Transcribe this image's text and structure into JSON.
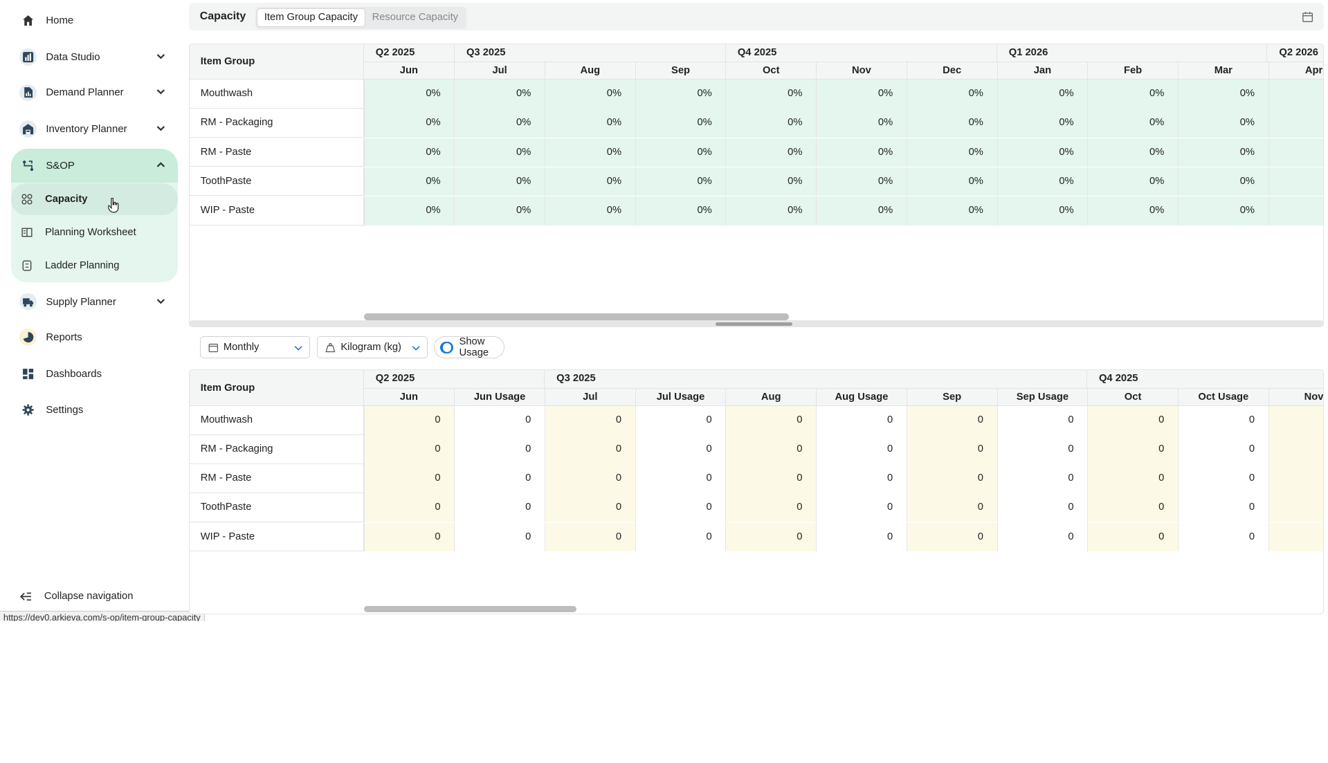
{
  "nav": {
    "items": [
      {
        "label": "Home",
        "icon": "home-icon"
      },
      {
        "label": "Data Studio",
        "icon": "bar-chart-icon"
      },
      {
        "label": "Demand Planner",
        "icon": "document-chart-icon"
      },
      {
        "label": "Inventory Planner",
        "icon": "warehouse-icon"
      },
      {
        "label": "S&OP",
        "icon": "route-icon"
      },
      {
        "label": "Supply Planner",
        "icon": "truck-icon"
      },
      {
        "label": "Reports",
        "icon": "pie-chart-icon"
      },
      {
        "label": "Dashboards",
        "icon": "dashboard-grid-icon"
      },
      {
        "label": "Settings",
        "icon": "gear-icon"
      }
    ],
    "sop_children": [
      {
        "label": "Capacity",
        "icon": "grid-dots-icon"
      },
      {
        "label": "Planning Worksheet",
        "icon": "worksheet-icon"
      },
      {
        "label": "Ladder Planning",
        "icon": "ladder-icon"
      }
    ],
    "collapse_label": "Collapse navigation",
    "accent_color": "#c9ecdb"
  },
  "status_url": "https://dev0.arkieva.com/s-op/item-group-capacity",
  "header": {
    "title": "Capacity",
    "tabs": [
      {
        "label": "Item Group Capacity",
        "active": true
      },
      {
        "label": "Resource Capacity",
        "active": false
      }
    ]
  },
  "top_grid": {
    "row_header": "Item Group",
    "quarters": [
      "Q2 2025",
      "Q3 2025",
      "Q4 2025",
      "Q1 2026",
      "Q2 2026"
    ],
    "months": [
      "Jun",
      "Jul",
      "Aug",
      "Sep",
      "Oct",
      "Nov",
      "Dec",
      "Jan",
      "Feb",
      "Mar",
      "Apr"
    ],
    "rows": [
      {
        "name": "Mouthwash",
        "values": [
          "0%",
          "0%",
          "0%",
          "0%",
          "0%",
          "0%",
          "0%",
          "0%",
          "0%",
          "0%",
          ""
        ]
      },
      {
        "name": "RM - Packaging",
        "values": [
          "0%",
          "0%",
          "0%",
          "0%",
          "0%",
          "0%",
          "0%",
          "0%",
          "0%",
          "0%",
          ""
        ]
      },
      {
        "name": "RM - Paste",
        "values": [
          "0%",
          "0%",
          "0%",
          "0%",
          "0%",
          "0%",
          "0%",
          "0%",
          "0%",
          "0%",
          ""
        ]
      },
      {
        "name": "ToothPaste",
        "values": [
          "0%",
          "0%",
          "0%",
          "0%",
          "0%",
          "0%",
          "0%",
          "0%",
          "0%",
          "0%",
          ""
        ]
      },
      {
        "name": "WIP - Paste",
        "values": [
          "0%",
          "0%",
          "0%",
          "0%",
          "0%",
          "0%",
          "0%",
          "0%",
          "0%",
          "0%",
          ""
        ]
      }
    ],
    "cell_color": "#e4f6ee"
  },
  "toolbar": {
    "period": "Monthly",
    "unit": "Kilogram (kg)",
    "show_usage_label": "Show Usage",
    "show_usage_on": true
  },
  "bottom_grid": {
    "row_header": "Item Group",
    "quarters": [
      "Q2 2025",
      "Q3 2025",
      "Q4 2025"
    ],
    "columns": [
      "Jun",
      "Jun Usage",
      "Jul",
      "Jul Usage",
      "Aug",
      "Aug Usage",
      "Sep",
      "Sep Usage",
      "Oct",
      "Oct Usage",
      "Nov"
    ],
    "rows": [
      {
        "name": "Mouthwash",
        "values": [
          "0",
          "0",
          "0",
          "0",
          "0",
          "0",
          "0",
          "0",
          "0",
          "0",
          ""
        ]
      },
      {
        "name": "RM - Packaging",
        "values": [
          "0",
          "0",
          "0",
          "0",
          "0",
          "0",
          "0",
          "0",
          "0",
          "0",
          ""
        ]
      },
      {
        "name": "RM - Paste",
        "values": [
          "0",
          "0",
          "0",
          "0",
          "0",
          "0",
          "0",
          "0",
          "0",
          "0",
          ""
        ]
      },
      {
        "name": "ToothPaste",
        "values": [
          "0",
          "0",
          "0",
          "0",
          "0",
          "0",
          "0",
          "0",
          "0",
          "0",
          ""
        ]
      },
      {
        "name": "WIP - Paste",
        "values": [
          "0",
          "0",
          "0",
          "0",
          "0",
          "0",
          "0",
          "0",
          "0",
          "0",
          ""
        ]
      }
    ],
    "value_cell_color": "#fcfae6"
  }
}
